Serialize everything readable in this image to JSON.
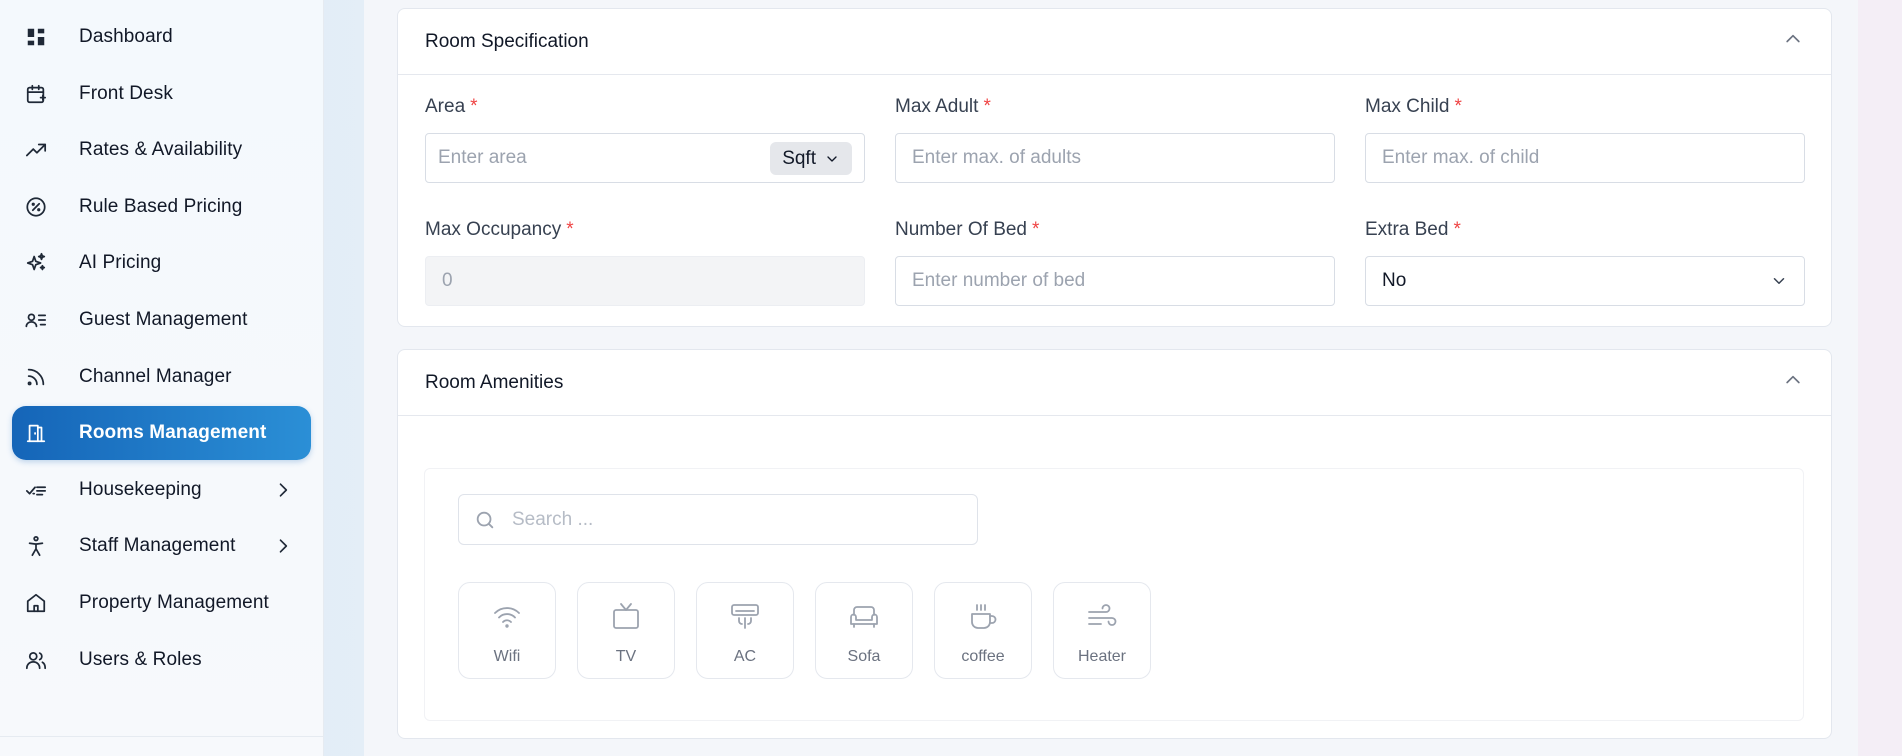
{
  "sidebar": {
    "items": [
      {
        "label": "Dashboard",
        "icon": "dashboard-icon"
      },
      {
        "label": "Front Desk",
        "icon": "calendar-plus-icon"
      },
      {
        "label": "Rates & Availability",
        "icon": "trending-up-icon"
      },
      {
        "label": "Rule Based Pricing",
        "icon": "percent-badge-icon"
      },
      {
        "label": "AI Pricing",
        "icon": "sparkles-icon"
      },
      {
        "label": "Guest Management",
        "icon": "user-list-icon"
      },
      {
        "label": "Channel Manager",
        "icon": "rss-icon"
      },
      {
        "label": "Rooms Management",
        "icon": "door-icon",
        "active": true
      },
      {
        "label": "Housekeeping",
        "icon": "checklist-icon",
        "has_submenu": true
      },
      {
        "label": "Staff Management",
        "icon": "person-icon",
        "has_submenu": true
      },
      {
        "label": "Property Management",
        "icon": "home-icon"
      },
      {
        "label": "Users & Roles",
        "icon": "users-icon"
      }
    ],
    "active_color": "#1e78c8"
  },
  "room_specification": {
    "title": "Room Specification",
    "area": {
      "label": "Area",
      "placeholder": "Enter area",
      "unit": "Sqft"
    },
    "max_adult": {
      "label": "Max Adult",
      "placeholder": "Enter max. of adults"
    },
    "max_child": {
      "label": "Max Child",
      "placeholder": "Enter max. of child"
    },
    "max_occupancy": {
      "label": "Max Occupancy",
      "value": "0"
    },
    "number_of_bed": {
      "label": "Number Of Bed",
      "placeholder": "Enter number of bed"
    },
    "extra_bed": {
      "label": "Extra Bed",
      "value": "No"
    },
    "required_marker": "*"
  },
  "room_amenities": {
    "title": "Room Amenities",
    "search_placeholder": "Search ...",
    "items": [
      {
        "label": "Wifi",
        "icon": "wifi-icon"
      },
      {
        "label": "TV",
        "icon": "tv-icon"
      },
      {
        "label": "AC",
        "icon": "air-conditioner-icon"
      },
      {
        "label": "Sofa",
        "icon": "sofa-icon"
      },
      {
        "label": "coffee",
        "icon": "coffee-icon"
      },
      {
        "label": "Heater",
        "icon": "wind-icon"
      }
    ]
  }
}
